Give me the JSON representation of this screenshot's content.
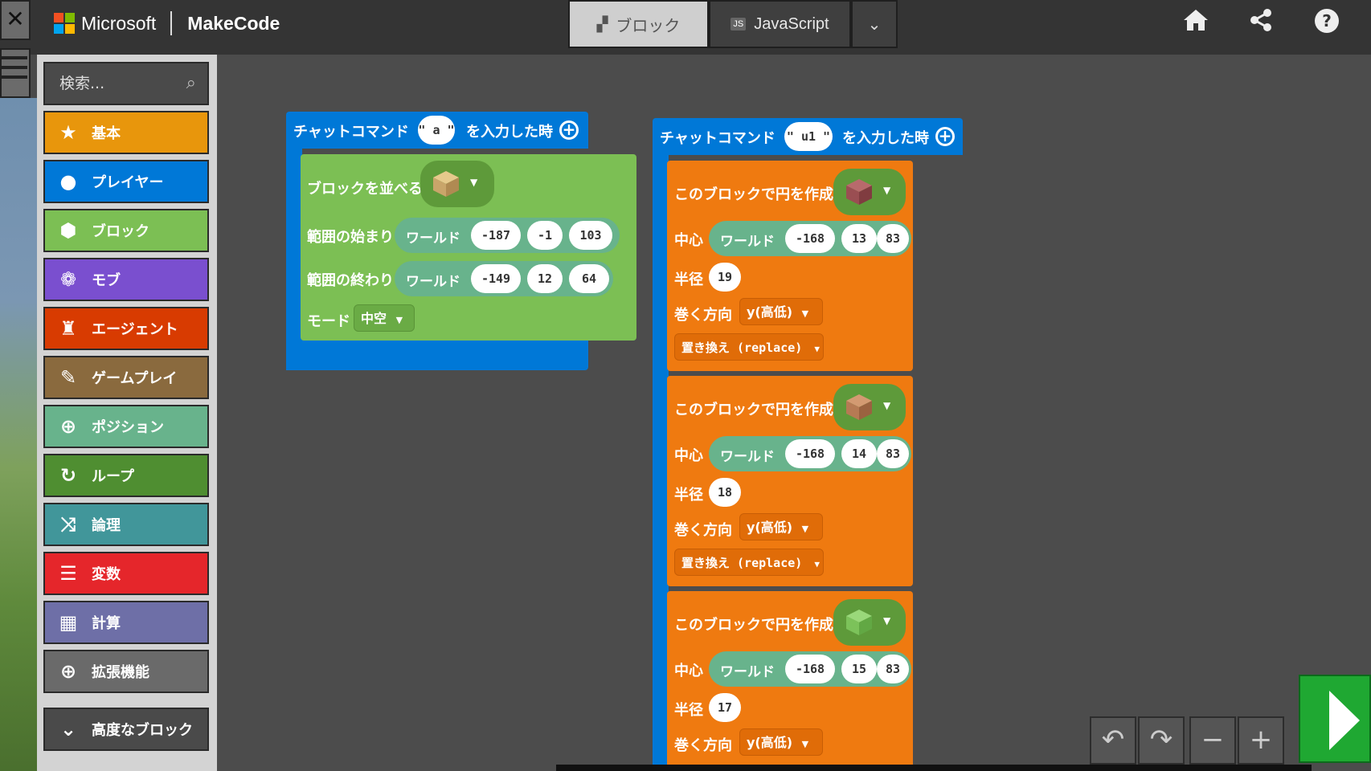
{
  "header": {
    "brand": "Microsoft",
    "product": "MakeCode",
    "tabs": [
      {
        "label": "ブロック",
        "icon": "puzzle-icon"
      },
      {
        "label": "JavaScript",
        "icon": "js-icon"
      }
    ],
    "icons": [
      "home-icon",
      "share-icon",
      "help-icon"
    ]
  },
  "palette": {
    "search_placeholder": "検索...",
    "categories": [
      {
        "label": "基本",
        "color": "#E8960C",
        "icon": "star-icon"
      },
      {
        "label": "プレイヤー",
        "color": "#0078D7",
        "icon": "person-icon"
      },
      {
        "label": "ブロック",
        "color": "#7CBF54",
        "icon": "cube-icon"
      },
      {
        "label": "モブ",
        "color": "#7A4FCF",
        "icon": "paw-icon"
      },
      {
        "label": "エージェント",
        "color": "#D83B01",
        "icon": "agent-icon"
      },
      {
        "label": "ゲームプレイ",
        "color": "#8A6A3E",
        "icon": "wrench-icon"
      },
      {
        "label": "ポジション",
        "color": "#68B38C",
        "icon": "crosshair-icon"
      },
      {
        "label": "ループ",
        "color": "#4F8E31",
        "icon": "loop-icon"
      },
      {
        "label": "論理",
        "color": "#41969A",
        "icon": "shuffle-icon"
      },
      {
        "label": "変数",
        "color": "#E5262B",
        "icon": "list-icon"
      },
      {
        "label": "計算",
        "color": "#6E6FA7",
        "icon": "calculator-icon"
      },
      {
        "label": "拡張機能",
        "color": "#6A6A6A",
        "icon": "plus-circle-icon"
      }
    ],
    "advanced": "高度なブロック"
  },
  "workspace": {
    "block_a": {
      "event_prefix": "チャットコマンド",
      "command": "\" a \"",
      "event_suffix": "を入力した時",
      "fill_label": "ブロックを並べる",
      "from_label": "範囲の始まり",
      "to_label": "範囲の終わり",
      "world_label": "ワールド",
      "from": [
        "-187",
        "-1",
        "103"
      ],
      "to": [
        "-149",
        "12",
        "64"
      ],
      "mode_label": "モード",
      "mode_value": "中空"
    },
    "block_u1": {
      "event_prefix": "チャットコマンド",
      "command": "\" u1 \"",
      "event_suffix": "を入力した時",
      "circles": [
        {
          "label": "このブロックで円を作成:",
          "center_label": "中心",
          "world_label": "ワールド",
          "center": [
            "-168",
            "13",
            "83"
          ],
          "radius_label": "半径",
          "radius": "19",
          "dir_label": "巻く方向",
          "dir": "y(高低)",
          "replace": "置き換え (replace)",
          "block_color": "#A14E52"
        },
        {
          "label": "このブロックで円を作成:",
          "center_label": "中心",
          "world_label": "ワールド",
          "center": [
            "-168",
            "14",
            "83"
          ],
          "radius_label": "半径",
          "radius": "18",
          "dir_label": "巻く方向",
          "dir": "y(高低)",
          "replace": "置き換え (replace)",
          "block_color": "#B97A56"
        },
        {
          "label": "このブロックで円を作成:",
          "center_label": "中心",
          "world_label": "ワールド",
          "center": [
            "-168",
            "15",
            "83"
          ],
          "radius_label": "半径",
          "radius": "17",
          "dir_label": "巻く方向",
          "dir": "y(高低)",
          "block_color": "#7CC25A"
        }
      ]
    }
  },
  "controls": [
    "undo-icon",
    "redo-icon",
    "zoom-out-icon",
    "zoom-in-icon",
    "run-icon"
  ]
}
